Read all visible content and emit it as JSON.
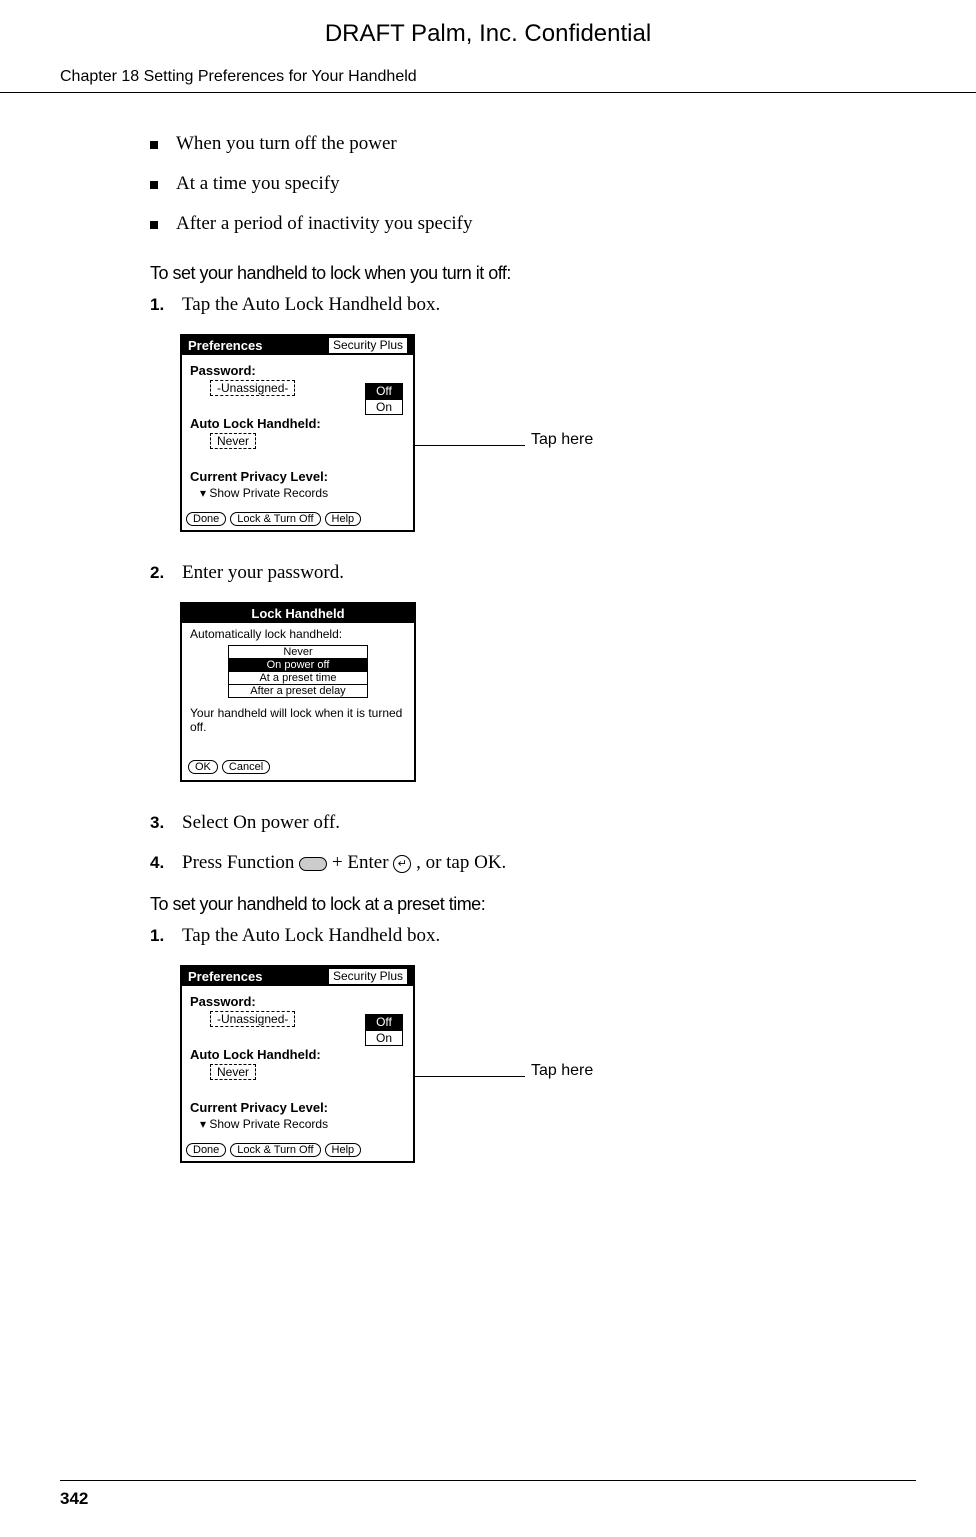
{
  "draft_header": "DRAFT   Palm, Inc. Confidential",
  "chapter_header": "Chapter 18   Setting Preferences for Your Handheld",
  "bullets": [
    "When you turn off the power",
    "At a time you specify",
    "After a period of inactivity you specify"
  ],
  "section1": {
    "heading": "To set your handheld to lock when you turn it off:",
    "steps": [
      {
        "num": "1.",
        "text": "Tap the Auto Lock Handheld box."
      },
      {
        "num": "2.",
        "text": "Enter your password."
      },
      {
        "num": "3.",
        "text": "Select On power off."
      },
      {
        "num": "4.",
        "text_pre": "Press Function ",
        "text_mid": " + Enter ",
        "text_post": ", or tap OK."
      }
    ]
  },
  "section2": {
    "heading": "To set your handheld to lock at a preset time:",
    "steps": [
      {
        "num": "1.",
        "text": "Tap the Auto Lock Handheld box."
      }
    ]
  },
  "prefs_screen": {
    "title_left": "Preferences",
    "title_right": "Security Plus",
    "password_label": "Password:",
    "unassigned": "-Unassigned-",
    "off": "Off",
    "on": "On",
    "autolock_label": "Auto Lock Handheld:",
    "never": "Never",
    "privacy_label": "Current Privacy Level:",
    "privacy_value": "▾ Show Private Records",
    "buttons": {
      "done": "Done",
      "lockoff": "Lock & Turn Off",
      "help": "Help"
    },
    "callout": "Tap here"
  },
  "lock_screen": {
    "title": "Lock Handheld",
    "prompt": "Automatically lock handheld:",
    "options": [
      "Never",
      "On power off",
      "At a preset time",
      "After a preset delay"
    ],
    "selected_index": 1,
    "message": "Your handheld will lock when it is turned off.",
    "buttons": {
      "ok": "OK",
      "cancel": "Cancel"
    }
  },
  "page_number": "342"
}
